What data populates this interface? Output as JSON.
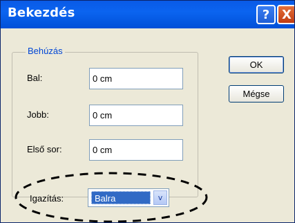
{
  "window": {
    "title": "Bekezdés",
    "help_glyph": "?",
    "close_glyph": "X"
  },
  "indent_group": {
    "legend": "Behúzás",
    "left_label": "Bal:",
    "left_value": "0 cm",
    "right_label": "Jobb:",
    "right_value": "0 cm",
    "first_line_label": "Első sor:",
    "first_line_value": "0 cm"
  },
  "buttons": {
    "ok": "OK",
    "cancel": "Mégse"
  },
  "alignment": {
    "label": "Igazítás:",
    "selected": "Balra",
    "dropdown_glyph": "v"
  }
}
